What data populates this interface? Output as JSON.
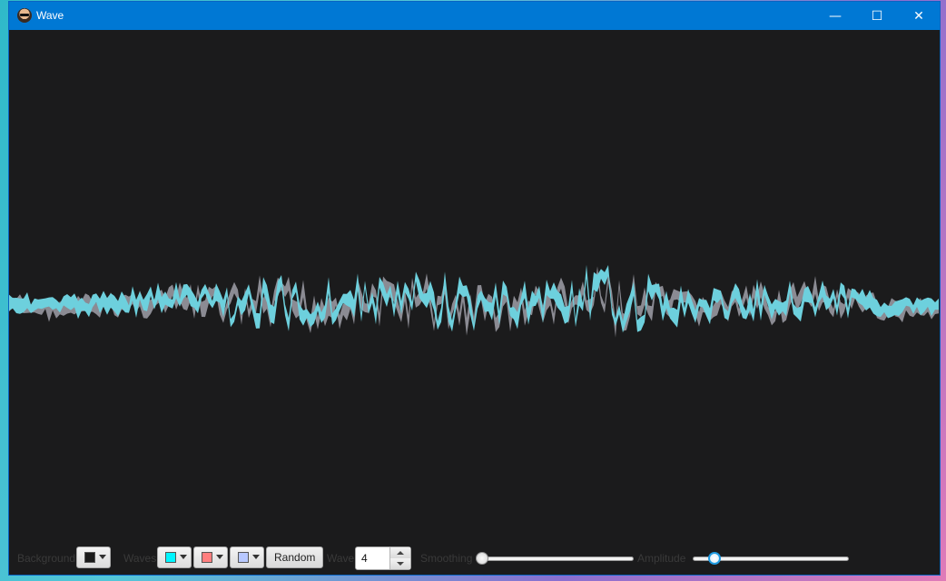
{
  "window": {
    "title": "Wave",
    "minimize_symbol": "—",
    "maximize_symbol": "☐",
    "close_symbol": "✕",
    "app_icon": "sunglasses-avatar-icon"
  },
  "colors": {
    "titlebar": "#0078d4",
    "canvas_background": "#1b1b1c",
    "wave_front": "#6dd0dd",
    "wave_back": "#8b8b93"
  },
  "controls": {
    "background_label": "Background",
    "background_color": "#1a1a1a",
    "waves_label": "Waves",
    "wave_colors": [
      "#00f5ff",
      "#ff7f7f",
      "#b8c8ff"
    ],
    "random_label": "Random",
    "wave_label": "Wave",
    "wave_value": "4",
    "smoothing_label": "Smoothing",
    "smoothing_fraction": 0.0,
    "amplitude_label": "Amplitude",
    "amplitude_fraction": 0.11
  }
}
